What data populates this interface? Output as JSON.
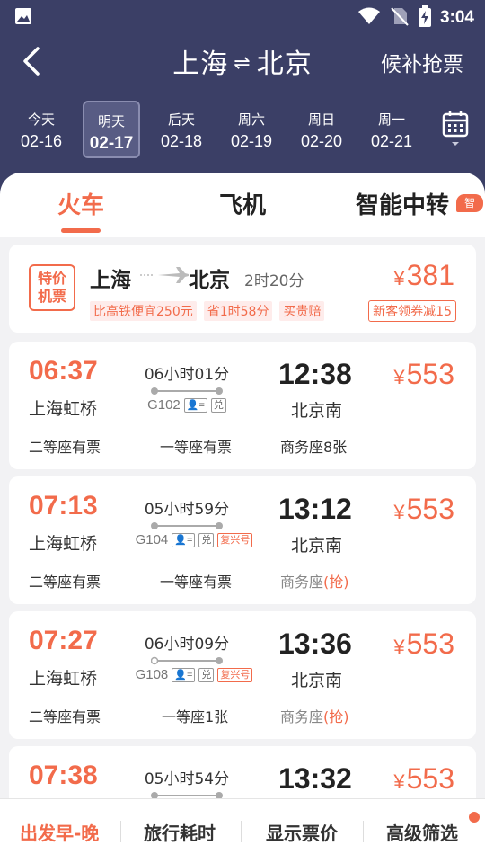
{
  "status": {
    "time": "3:04"
  },
  "header": {
    "from": "上海",
    "to": "北京",
    "waitlist": "候补抢票"
  },
  "dates": [
    {
      "weekday": "今天",
      "date": "02-16",
      "active": false
    },
    {
      "weekday": "明天",
      "date": "02-17",
      "active": true
    },
    {
      "weekday": "后天",
      "date": "02-18",
      "active": false
    },
    {
      "weekday": "周六",
      "date": "02-19",
      "active": false
    },
    {
      "weekday": "周日",
      "date": "02-20",
      "active": false
    },
    {
      "weekday": "周一",
      "date": "02-21",
      "active": false
    }
  ],
  "tabs": {
    "train": "火车",
    "plane": "飞机",
    "transfer": "智能中转",
    "badge": "智"
  },
  "flight": {
    "badge": "特价机票",
    "badge_line1": "特价",
    "badge_line2": "机票",
    "from": "上海",
    "to": "北京",
    "duration": "2时20分",
    "price": "381",
    "tags": [
      "比高铁便宜250元",
      "省1时58分",
      "买贵赔"
    ],
    "coupon": "新客领券减15"
  },
  "trains": [
    {
      "dep": "06:37",
      "dep_station": "上海虹桥",
      "duration": "06小时01分",
      "code": "G102",
      "fuxing": "",
      "arr": "12:38",
      "arr_station": "北京南",
      "price": "553",
      "seats": [
        {
          "label": "二等座有票"
        },
        {
          "label": "一等座有票"
        },
        {
          "label": "商务座8张"
        }
      ]
    },
    {
      "dep": "07:13",
      "dep_station": "上海虹桥",
      "duration": "05小时59分",
      "code": "G104",
      "fuxing": "复兴号",
      "arr": "13:12",
      "arr_station": "北京南",
      "price": "553",
      "seats": [
        {
          "label": "二等座有票"
        },
        {
          "label": "一等座有票"
        },
        {
          "label": "商务座",
          "grab": "(抢)"
        }
      ]
    },
    {
      "dep": "07:27",
      "dep_station": "上海虹桥",
      "duration": "06小时09分",
      "code": "G108",
      "fuxing": "复兴号",
      "arr": "13:36",
      "arr_station": "北京南",
      "price": "553",
      "seats": [
        {
          "label": "二等座有票"
        },
        {
          "label": "一等座1张"
        },
        {
          "label": "商务座",
          "grab": "(抢)"
        }
      ]
    },
    {
      "dep": "07:38",
      "dep_station": "",
      "duration": "05小时54分",
      "code": "",
      "fuxing": "",
      "arr": "13:32",
      "arr_station": "",
      "price": "553",
      "seats": []
    }
  ],
  "icons": {
    "id_card": "身份证",
    "exchange": "兑",
    "yen": "¥"
  },
  "bottom": {
    "sort_depart": "出发早-晚",
    "sort_duration": "旅行耗时",
    "show_price": "显示票价",
    "filter": "高级筛选"
  }
}
